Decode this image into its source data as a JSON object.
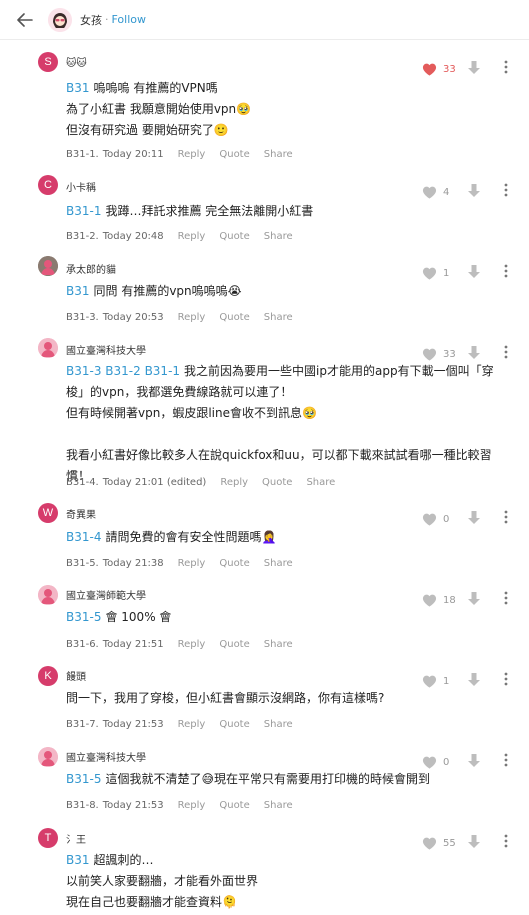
{
  "header": {
    "author": "女孩",
    "separator": "·",
    "follow_label": "Follow"
  },
  "actions": {
    "reply": "Reply",
    "quote": "Quote",
    "share": "Share"
  },
  "colors": {
    "accent": "#3397cf",
    "like_active": "#e35b5b",
    "icon_gray": "#bdbdbd"
  },
  "comments": [
    {
      "initial": "S",
      "avatar_color": "#d63c6b",
      "author": "🐱🐱",
      "floor": "B31-1",
      "time": "Today 20:11",
      "likes": "33",
      "lines": [
        {
          "ref": "B31",
          "text": "嗚嗚嗚 有推薦的VPN嗎"
        },
        {
          "ref": "",
          "text": "為了小紅書 我願意開始使用vpn🥹"
        },
        {
          "ref": "",
          "text": "但沒有研究過 要開始研究了🙂"
        }
      ]
    },
    {
      "initial": "C",
      "avatar_color": "#d63c6b",
      "author": "小卡稱",
      "floor": "B31-2",
      "time": "Today 20:48",
      "likes": "4",
      "lines": [
        {
          "ref": "B31-1",
          "text": "我蹲…拜託求推薦 完全無法離開小紅書"
        }
      ]
    },
    {
      "initial": "",
      "avatar_color": "#8a7a70",
      "author": "承太郎的貓",
      "floor": "B31-3",
      "time": "Today 20:53",
      "likes": "1",
      "lines": [
        {
          "ref": "B31",
          "text": "同問 有推薦的vpn嗚嗚嗚😭"
        }
      ]
    },
    {
      "initial": "",
      "avatar_color": "#f3b6c6",
      "author": "國立臺灣科技大學",
      "floor": "B31-4",
      "time": "Today 21:01 (edited)",
      "likes": "33",
      "lines": [
        {
          "ref": "B31-3 B31-2 B31-1",
          "text": "我之前因為要用一些中國ip才能用的app有下載一個叫「穿梭」的vpn，我都選免費線路就可以連了！"
        },
        {
          "ref": "",
          "text": "但有時候開著vpn，蝦皮跟line會收不到訊息🥹"
        },
        {
          "ref": "",
          "text": ""
        },
        {
          "ref": "",
          "text": "我看小紅書好像比較多人在說quickfox和uu，可以都下載來試試看哪一種比較習慣！"
        }
      ]
    },
    {
      "initial": "W",
      "avatar_color": "#d63c6b",
      "author": "奇異果",
      "floor": "B31-5",
      "time": "Today 21:38",
      "likes": "0",
      "lines": [
        {
          "ref": "B31-4",
          "text": "請問免費的會有安全性問題嗎🤦‍♀️"
        }
      ]
    },
    {
      "initial": "",
      "avatar_color": "#f3b6c6",
      "author": "國立臺灣師範大學",
      "floor": "B31-6",
      "time": "Today 21:51",
      "likes": "18",
      "lines": [
        {
          "ref": "B31-5",
          "text": "會 100% 會"
        }
      ]
    },
    {
      "initial": "K",
      "avatar_color": "#d63c6b",
      "author": "饅頭",
      "floor": "B31-7",
      "time": "Today 21:53",
      "likes": "1",
      "lines": [
        {
          "ref": "",
          "text": "問一下，我用了穿梭，但小紅書會顯示沒網路，你有這樣嗎?"
        }
      ]
    },
    {
      "initial": "",
      "avatar_color": "#f3b6c6",
      "author": "國立臺灣科技大學",
      "floor": "B31-8",
      "time": "Today 21:53",
      "likes": "0",
      "lines": [
        {
          "ref": "B31-5",
          "text": "這個我就不清楚了😅現在平常只有需要用打印機的時候會開到"
        }
      ]
    },
    {
      "initial": "T",
      "avatar_color": "#d63c6b",
      "author": "氵王",
      "floor": "",
      "time": "",
      "likes": "55",
      "lines": [
        {
          "ref": "B31",
          "text": "超諷刺的…"
        },
        {
          "ref": "",
          "text": "以前笑人家要翻牆，才能看外面世界"
        },
        {
          "ref": "",
          "text": "現在自己也要翻牆才能查資料🫠"
        }
      ]
    }
  ]
}
